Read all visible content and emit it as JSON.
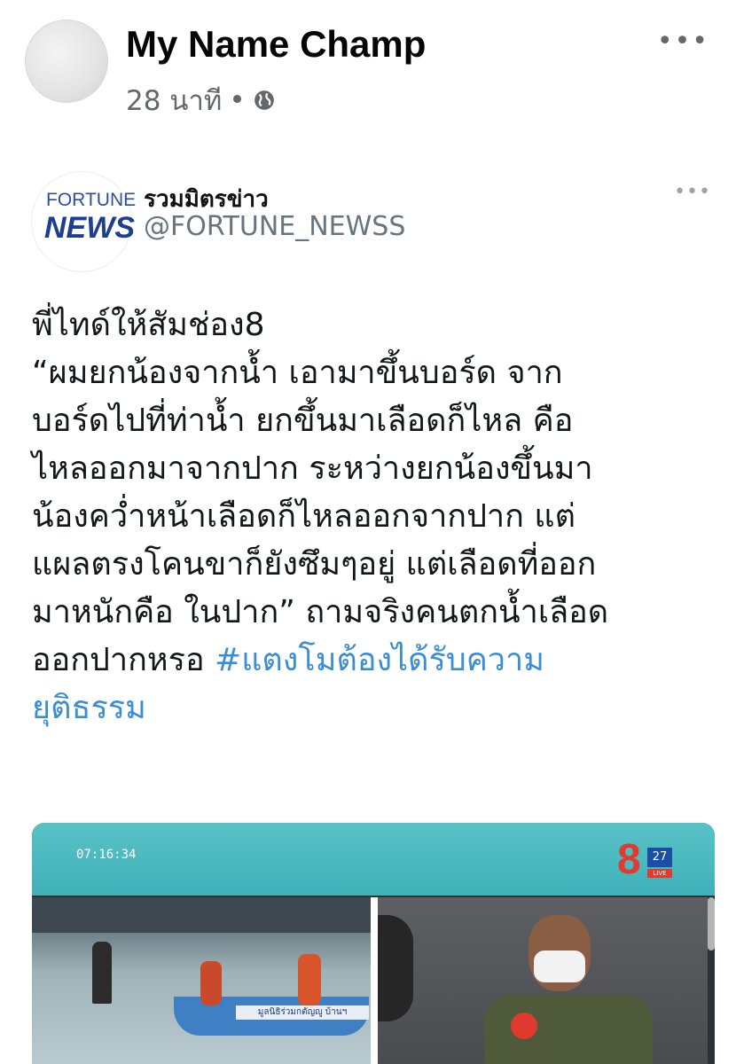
{
  "post": {
    "author": "My Name Champ",
    "time": "28 นาที",
    "separator": "•",
    "privacy_icon": "globe-icon",
    "more_icon": "•••"
  },
  "tweet": {
    "logo_top": "FORTUNE",
    "logo_bottom": "NEWS",
    "display_name": "รวมมิตรข่าว",
    "handle": "@FORTUNE_NEWSS",
    "more_icon": "•••",
    "lines": [
      "พี่ไทด์ให้สัมช่อง8",
      "“ผมยกน้องจากน้ำ เอามาขึ้นบอร์ด จาก",
      "บอร์ดไปที่ท่าน้ำ ยกขึ้นมาเลือดก็ไหล คือ",
      "ไหลออกมาจากปาก ระหว่างยกน้องขึ้นมา",
      "น้องคว่ำหน้าเลือดก็ไหลออกจากปาก แต่",
      "แผลตรงโคนขาก็ยังซึมๆอยู่ แต่เลือดที่ออก",
      "มาหนักคือ ในปาก” ถามจริงคนตกน้ำเลือด"
    ],
    "last_line_text": "ออกปากหรอ ",
    "hashtag_part1": "#แตงโมต้องได้รับความ",
    "hashtag_part2": "ยุติธรรม"
  },
  "media": {
    "timecode": "07:16:34",
    "channel_number": "8",
    "channel_box": "27",
    "channel_live": "LIVE",
    "boat_label": "มูลนิธิร่วมกตัญญู บ้านฯ"
  }
}
